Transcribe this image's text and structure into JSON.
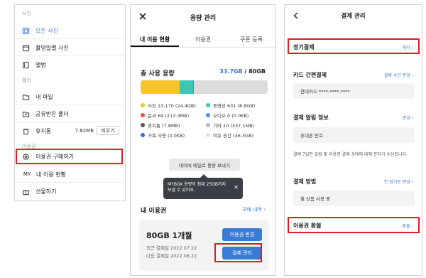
{
  "panel1": {
    "section_photo": "사진",
    "section_folder": "폴더",
    "section_pass": "이용권",
    "items": [
      {
        "label": "모든 사진",
        "icon": "photo-grid-icon",
        "active": true
      },
      {
        "label": "촬영일별 사진",
        "icon": "calendar-icon"
      },
      {
        "label": "앨범",
        "icon": "album-icon"
      },
      {
        "label": "내 파일",
        "icon": "folder-icon"
      },
      {
        "label": "공유받은 폴더",
        "icon": "shared-folder-icon"
      },
      {
        "label": "휴지통",
        "icon": "trash-icon"
      },
      {
        "label": "이용권 구매하기",
        "icon": "gear-icon"
      },
      {
        "label": "내 이용 현황",
        "icon": "my-text-icon",
        "prefix": "MY"
      },
      {
        "label": "선물하기",
        "icon": "gift-icon"
      }
    ],
    "trash_size": "7.82MB",
    "empty_label": "비우기"
  },
  "panel2": {
    "title": "용량 관리",
    "tabs": [
      "내 이용 현황",
      "이용권",
      "쿠폰 등록"
    ],
    "usage_title": "총 사용 용량",
    "usage_used": "33.7GB",
    "usage_total": " / 80GB",
    "segments": [
      {
        "value": 24.4,
        "color": "#f5c52b"
      },
      {
        "value": 8.8,
        "color": "#3cc6b4"
      },
      {
        "value": 0.2,
        "color": "#e5533b"
      }
    ],
    "bar_max": 80,
    "legend": [
      {
        "label": "사진 13,170 (24.4GB)",
        "color": "#f5c52b"
      },
      {
        "label": "동영상 631 (8.8GB)",
        "color": "#3cc6b4"
      },
      {
        "label": "문서 69 (213.3MB)",
        "color": "#e5533b"
      },
      {
        "label": "오디오 0 (0.0KB)",
        "color": "#4d8ef0"
      },
      {
        "label": "휴지통 (7.8MB)",
        "color": "#555555"
      },
      {
        "label": "기타 10 (337.1MB)",
        "color": "#b9bec6"
      },
      {
        "label": "가족 사용 (0.0KB)",
        "color": "#2f6fe4"
      },
      {
        "label": "여유 공간 (46.3GB)",
        "color": "#e2e2e2"
      }
    ],
    "send_label": "네이버 메일로 용량 보내기",
    "tooltip_line1": "MYBOX 용량의 최대 25GB까지",
    "tooltip_line2": "보낼 수 있어요.",
    "my_pass": "내 이용권",
    "buy_history": "구매 내역 ›",
    "pass_name": "80GB 1개월",
    "last_pay": "최근 결제일 2022.07.22",
    "next_pay": "다음 결제일 2022.08.22",
    "change_label": "이용권 변경",
    "manage_label": "결제 관리"
  },
  "panel3": {
    "title": "결제 관리",
    "regular": "정기결제",
    "cancel": "해지 ›",
    "card_title": "카드 간편결제",
    "card_link": "결제 수단 변경 ›",
    "card_value": "현대카드 ****-****-****",
    "alert_title": "결제 알림 정보",
    "alert_link": "변경 ›",
    "alert_value": "휴대폰 번호",
    "desc": "결제 7일전 알림 및 이용권 결제 상태에 대해 문자가 수신됩니다.",
    "method_title": "결제 방법",
    "method_link": "연 정기로 변경 ›",
    "method_value": "월 상품 사용 중",
    "refund_title": "이용권 환불",
    "refund_link": "환불 ›"
  }
}
